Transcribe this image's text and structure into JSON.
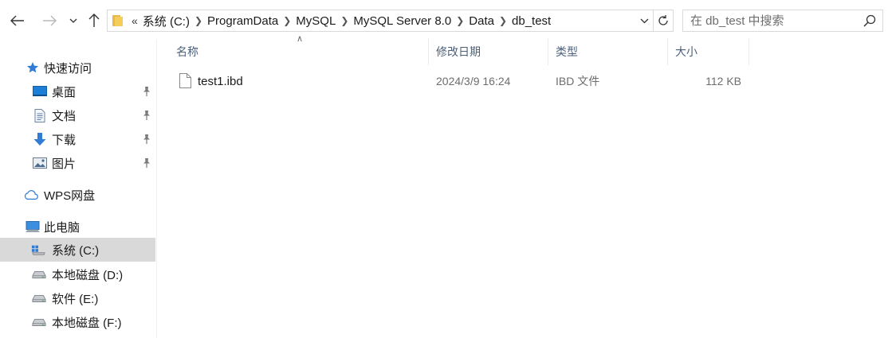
{
  "toolbar": {
    "back_icon": "arrow-left-icon",
    "forward_icon": "arrow-right-icon",
    "recent_icon": "chevron-down-icon",
    "up_icon": "arrow-up-icon"
  },
  "address": {
    "overflow": "«",
    "crumbs": [
      "系统 (C:)",
      "ProgramData",
      "MySQL",
      "MySQL Server 8.0",
      "Data",
      "db_test"
    ]
  },
  "search": {
    "placeholder": "在 db_test 中搜索"
  },
  "sidebar": {
    "items": [
      {
        "label": "快速访问",
        "icon": "star-icon"
      },
      {
        "label": "桌面",
        "icon": "desktop-icon",
        "pinned": true
      },
      {
        "label": "文档",
        "icon": "documents-icon",
        "pinned": true
      },
      {
        "label": "下载",
        "icon": "download-icon",
        "pinned": true
      },
      {
        "label": "图片",
        "icon": "pictures-icon",
        "pinned": true
      },
      {
        "label": "WPS网盘",
        "icon": "cloud-icon"
      },
      {
        "label": "此电脑",
        "icon": "computer-icon"
      },
      {
        "label": "系统 (C:)",
        "icon": "windows-drive-icon",
        "selected": true
      },
      {
        "label": "本地磁盘 (D:)",
        "icon": "drive-icon"
      },
      {
        "label": "软件 (E:)",
        "icon": "drive-icon"
      },
      {
        "label": "本地磁盘 (F:)",
        "icon": "drive-icon"
      }
    ]
  },
  "columns": {
    "name": "名称",
    "date": "修改日期",
    "type": "类型",
    "size": "大小"
  },
  "files": [
    {
      "name": "test1.ibd",
      "date": "2024/3/9 16:24",
      "type": "IBD 文件",
      "size": "112 KB",
      "icon": "file-icon"
    }
  ],
  "colors": {
    "selected_bg": "#d9d9d9",
    "header_text": "#4c607a",
    "accent": "#2f7bd6"
  }
}
